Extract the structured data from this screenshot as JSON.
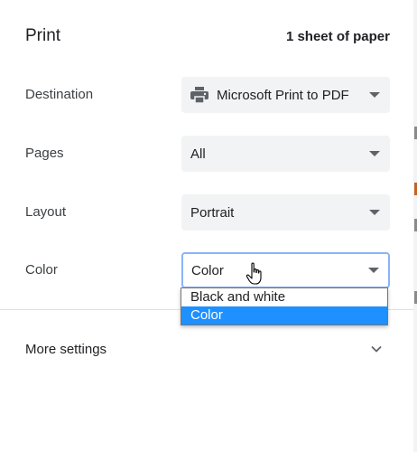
{
  "header": {
    "title": "Print",
    "sheet_count": "1 sheet of paper"
  },
  "destination": {
    "label": "Destination",
    "value": "Microsoft Print to PDF",
    "icon": "printer-icon"
  },
  "pages": {
    "label": "Pages",
    "value": "All"
  },
  "layout": {
    "label": "Layout",
    "value": "Portrait"
  },
  "color": {
    "label": "Color",
    "value": "Color",
    "options": [
      "Black and white",
      "Color"
    ],
    "selected_index": 1
  },
  "more_settings": {
    "label": "More settings",
    "icon": "chevron-down-icon"
  },
  "colors": {
    "select_bg": "#f1f3f4",
    "focus_border": "#8ab4f8",
    "option_highlight": "#1e90ff",
    "text": "#202124"
  }
}
